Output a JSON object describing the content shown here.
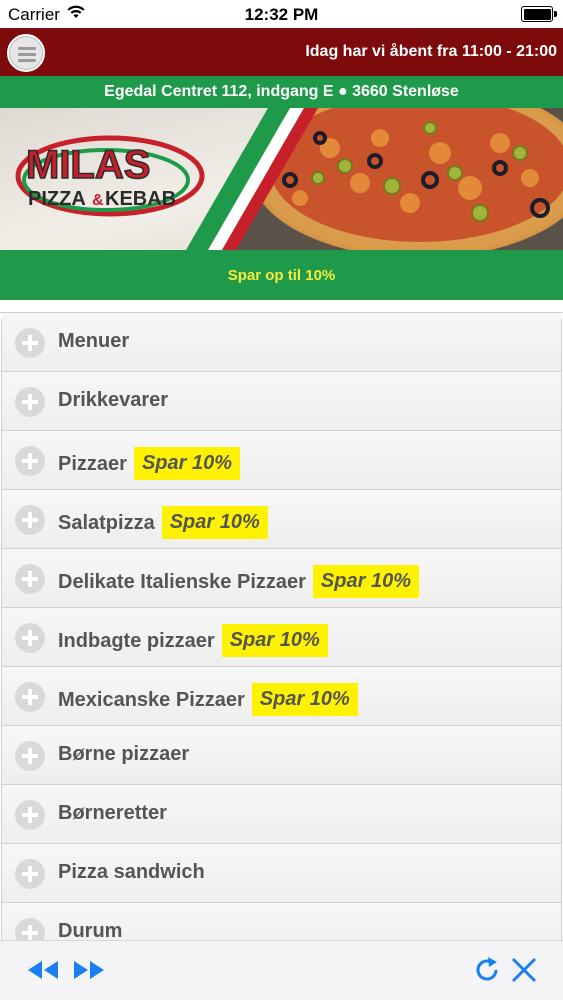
{
  "statusbar": {
    "carrier": "Carrier",
    "time": "12:32 PM"
  },
  "header": {
    "menu_icon": "hamburger-icon",
    "open_hours": "Idag har vi åbent fra 11:00 - 21:00",
    "address": "Egedal Centret 112, indgang E ● 3660 Stenløse"
  },
  "banner": {
    "logo_line1": "MILAS",
    "logo_line2_left": "PIZZA",
    "logo_line2_amp": "&",
    "logo_line2_right": "KEBAB"
  },
  "promo": {
    "save_text": "Spar op til 10%"
  },
  "categories": [
    {
      "label": "Menuer",
      "badge": ""
    },
    {
      "label": "Drikkevarer",
      "badge": ""
    },
    {
      "label": "Pizzaer",
      "badge": "Spar 10%"
    },
    {
      "label": "Salatpizza",
      "badge": "Spar 10%"
    },
    {
      "label": "Delikate Italienske Pizzaer",
      "badge": "Spar 10%"
    },
    {
      "label": "Indbagte pizzaer",
      "badge": "Spar 10%"
    },
    {
      "label": "Mexicanske Pizzaer",
      "badge": "Spar 10%"
    },
    {
      "label": "Børne pizzaer",
      "badge": ""
    },
    {
      "label": "Børneretter",
      "badge": ""
    },
    {
      "label": "Pizza sandwich",
      "badge": ""
    },
    {
      "label": "Durum",
      "badge": ""
    }
  ],
  "toolbar": {
    "back_icon": "rewind-icon",
    "forward_icon": "fast-forward-icon",
    "reload_icon": "reload-icon",
    "close_icon": "close-icon"
  },
  "colors": {
    "header_red": "#7d0b0c",
    "brand_green": "#1e9a4a",
    "badge_yellow": "#fff200",
    "promo_text_yellow": "#f5ec3c",
    "ios_blue": "#1a7ff0"
  }
}
